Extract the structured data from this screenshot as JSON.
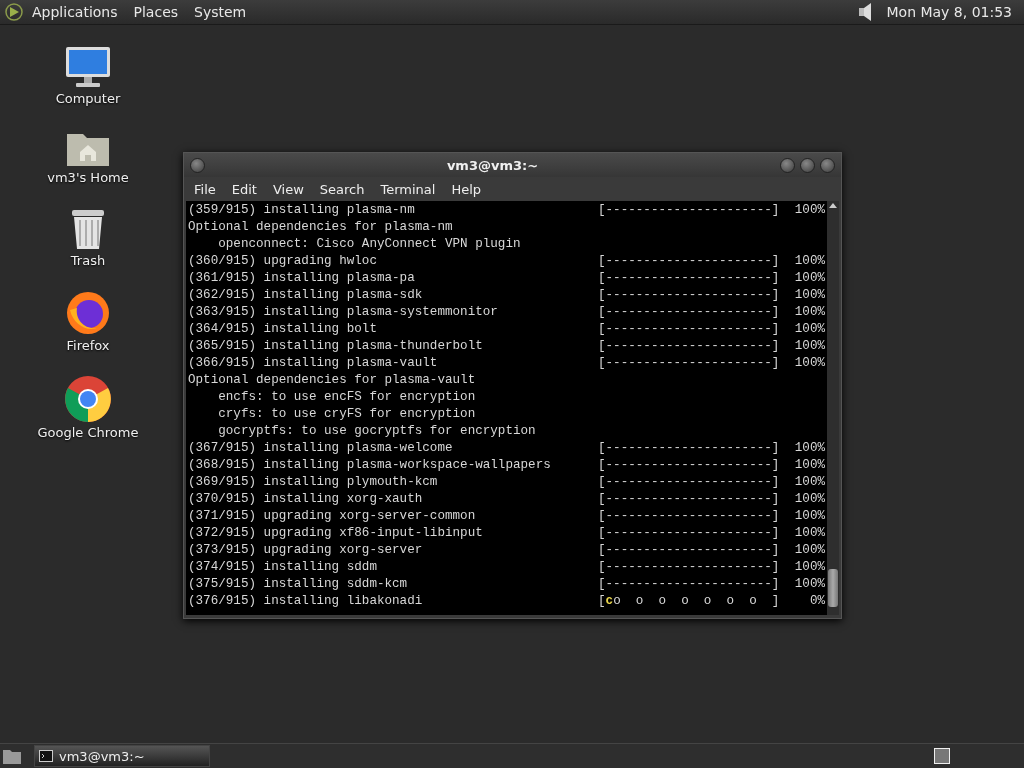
{
  "top_panel": {
    "menus": [
      "Applications",
      "Places",
      "System"
    ],
    "clock": "Mon May  8, 01:53"
  },
  "desktop_icons": [
    {
      "kind": "computer",
      "label": "Computer"
    },
    {
      "kind": "home",
      "label": "vm3's Home"
    },
    {
      "kind": "trash",
      "label": "Trash"
    },
    {
      "kind": "firefox",
      "label": "Firefox"
    },
    {
      "kind": "chrome",
      "label": "Google Chrome"
    }
  ],
  "window": {
    "title": "vm3@vm3:~",
    "menu": [
      "File",
      "Edit",
      "View",
      "Search",
      "Terminal",
      "Help"
    ],
    "lines": [
      {
        "kind": "progress",
        "text": "(359/915) installing plasma-nm",
        "bar": "[----------------------]",
        "percent": "100%"
      },
      {
        "kind": "plain",
        "text": "Optional dependencies for plasma-nm"
      },
      {
        "kind": "plain",
        "text": "    openconnect: Cisco AnyConnect VPN plugin"
      },
      {
        "kind": "progress",
        "text": "(360/915) upgrading hwloc",
        "bar": "[----------------------]",
        "percent": "100%"
      },
      {
        "kind": "progress",
        "text": "(361/915) installing plasma-pa",
        "bar": "[----------------------]",
        "percent": "100%"
      },
      {
        "kind": "progress",
        "text": "(362/915) installing plasma-sdk",
        "bar": "[----------------------]",
        "percent": "100%"
      },
      {
        "kind": "progress",
        "text": "(363/915) installing plasma-systemmonitor",
        "bar": "[----------------------]",
        "percent": "100%"
      },
      {
        "kind": "progress",
        "text": "(364/915) installing bolt",
        "bar": "[----------------------]",
        "percent": "100%"
      },
      {
        "kind": "progress",
        "text": "(365/915) installing plasma-thunderbolt",
        "bar": "[----------------------]",
        "percent": "100%"
      },
      {
        "kind": "progress",
        "text": "(366/915) installing plasma-vault",
        "bar": "[----------------------]",
        "percent": "100%"
      },
      {
        "kind": "plain",
        "text": "Optional dependencies for plasma-vault"
      },
      {
        "kind": "plain",
        "text": "    encfs: to use encFS for encryption"
      },
      {
        "kind": "plain",
        "text": "    cryfs: to use cryFS for encryption"
      },
      {
        "kind": "plain",
        "text": "    gocryptfs: to use gocryptfs for encryption"
      },
      {
        "kind": "progress",
        "text": "(367/915) installing plasma-welcome",
        "bar": "[----------------------]",
        "percent": "100%"
      },
      {
        "kind": "progress",
        "text": "(368/915) installing plasma-workspace-wallpapers",
        "bar": "[----------------------]",
        "percent": "100%"
      },
      {
        "kind": "progress",
        "text": "(369/915) installing plymouth-kcm",
        "bar": "[----------------------]",
        "percent": "100%"
      },
      {
        "kind": "progress",
        "text": "(370/915) installing xorg-xauth",
        "bar": "[----------------------]",
        "percent": "100%"
      },
      {
        "kind": "progress",
        "text": "(371/915) upgrading xorg-server-common",
        "bar": "[----------------------]",
        "percent": "100%"
      },
      {
        "kind": "progress",
        "text": "(372/915) upgrading xf86-input-libinput",
        "bar": "[----------------------]",
        "percent": "100%"
      },
      {
        "kind": "progress",
        "text": "(373/915) upgrading xorg-server",
        "bar": "[----------------------]",
        "percent": "100%"
      },
      {
        "kind": "progress",
        "text": "(374/915) installing sddm",
        "bar": "[----------------------]",
        "percent": "100%"
      },
      {
        "kind": "progress",
        "text": "(375/915) installing sddm-kcm",
        "bar": "[----------------------]",
        "percent": "100%"
      },
      {
        "kind": "pacman",
        "text": "(376/915) installing libakonadi",
        "bar_open": "[",
        "pacman": "c",
        "dots": "o  o  o  o  o  o  o  ]",
        "percent": "0%"
      }
    ]
  },
  "taskbar": {
    "tasks": [
      {
        "label": "vm3@vm3:~",
        "selected": true
      }
    ]
  }
}
